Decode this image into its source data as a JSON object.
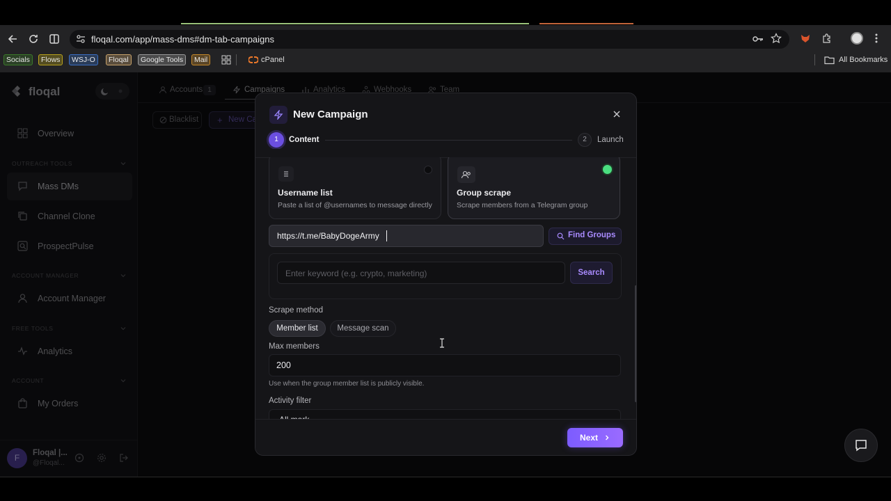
{
  "browser": {
    "url": "floqal.com/app/mass-dms#dm-tab-campaigns",
    "bookmarks": [
      {
        "label": "Socials",
        "color": "#3b7a2a"
      },
      {
        "label": "Flows",
        "color": "#b8a21c"
      },
      {
        "label": "WSJ-O",
        "color": "#3a6fc4"
      },
      {
        "label": "Floqal",
        "color": "#c9a36b"
      },
      {
        "label": "Google Tools",
        "color": "#9a9a9a"
      },
      {
        "label": "Mail",
        "color": "#c98a2a"
      }
    ],
    "cpanel": "cPanel",
    "all_bookmarks": "All Bookmarks"
  },
  "sidebar": {
    "brand": "floqal",
    "overview": "Overview",
    "sections": {
      "outreach": "OUTREACH TOOLS",
      "account_manager": "ACCOUNT MANAGER",
      "free_tools": "FREE TOOLS",
      "account": "ACCOUNT"
    },
    "items": {
      "mass_dms": "Mass DMs",
      "channel_clone": "Channel Clone",
      "prospect_pulse": "ProspectPulse",
      "account_manager": "Account Manager",
      "analytics": "Analytics",
      "my_orders": "My Orders"
    },
    "user": {
      "initial": "F",
      "name": "Floqal |...",
      "handle": "@Floqal..."
    }
  },
  "tabs": {
    "accounts": "Accounts",
    "accounts_count": "1",
    "campaigns": "Campaigns",
    "analytics": "Analytics",
    "webhooks": "Webhooks",
    "team": "Team"
  },
  "subbar": {
    "blacklist": "Blacklist",
    "new_campaign": "New Ca"
  },
  "modal": {
    "title": "New Campaign",
    "steps": [
      {
        "num": "1",
        "label": "Content"
      },
      {
        "num": "2",
        "label": "Launch"
      }
    ],
    "cards": {
      "username": {
        "title": "Username list",
        "desc": "Paste a list of @usernames to message directly"
      },
      "group": {
        "title": "Group scrape",
        "desc": "Scrape members from a Telegram group"
      }
    },
    "group_link_value": "https://t.me/BabyDogeArmy",
    "find_groups": "Find Groups",
    "keyword_placeholder": "Enter keyword (e.g. crypto, marketing)",
    "search": "Search",
    "scrape_method_label": "Scrape method",
    "scrape_methods": [
      "Member list",
      "Message scan"
    ],
    "max_members_label": "Max members",
    "max_members_value": "200",
    "hint": "Use when the group member list is publicly visible.",
    "activity_filter_label": "Activity filter",
    "activity_filter_value": "All mark",
    "next": "Next"
  },
  "colors": {
    "accent": "#7c5cff",
    "accent_light": "#a98bff",
    "success": "#4ade80"
  }
}
